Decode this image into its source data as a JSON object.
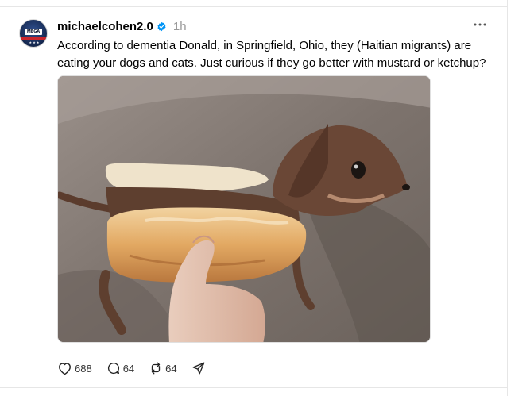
{
  "post": {
    "username": "michaelcohen2.0",
    "verified": true,
    "timestamp": "1h",
    "caption": "According to dementia Donald, in Springfield, Ohio, they (Haitian migrants) are eating your dogs and cats. Just curious if they go better with mustard or ketchup?",
    "avatar_text": "MEGA",
    "stats": {
      "likes": "688",
      "replies": "64",
      "reposts": "64"
    }
  },
  "colors": {
    "verified_badge": "#0095f6",
    "muted_text": "#999999",
    "divider": "#e6e6e6"
  },
  "icons": [
    "more-icon",
    "verified-badge-icon",
    "heart-icon",
    "comment-icon",
    "repost-icon",
    "share-icon"
  ]
}
